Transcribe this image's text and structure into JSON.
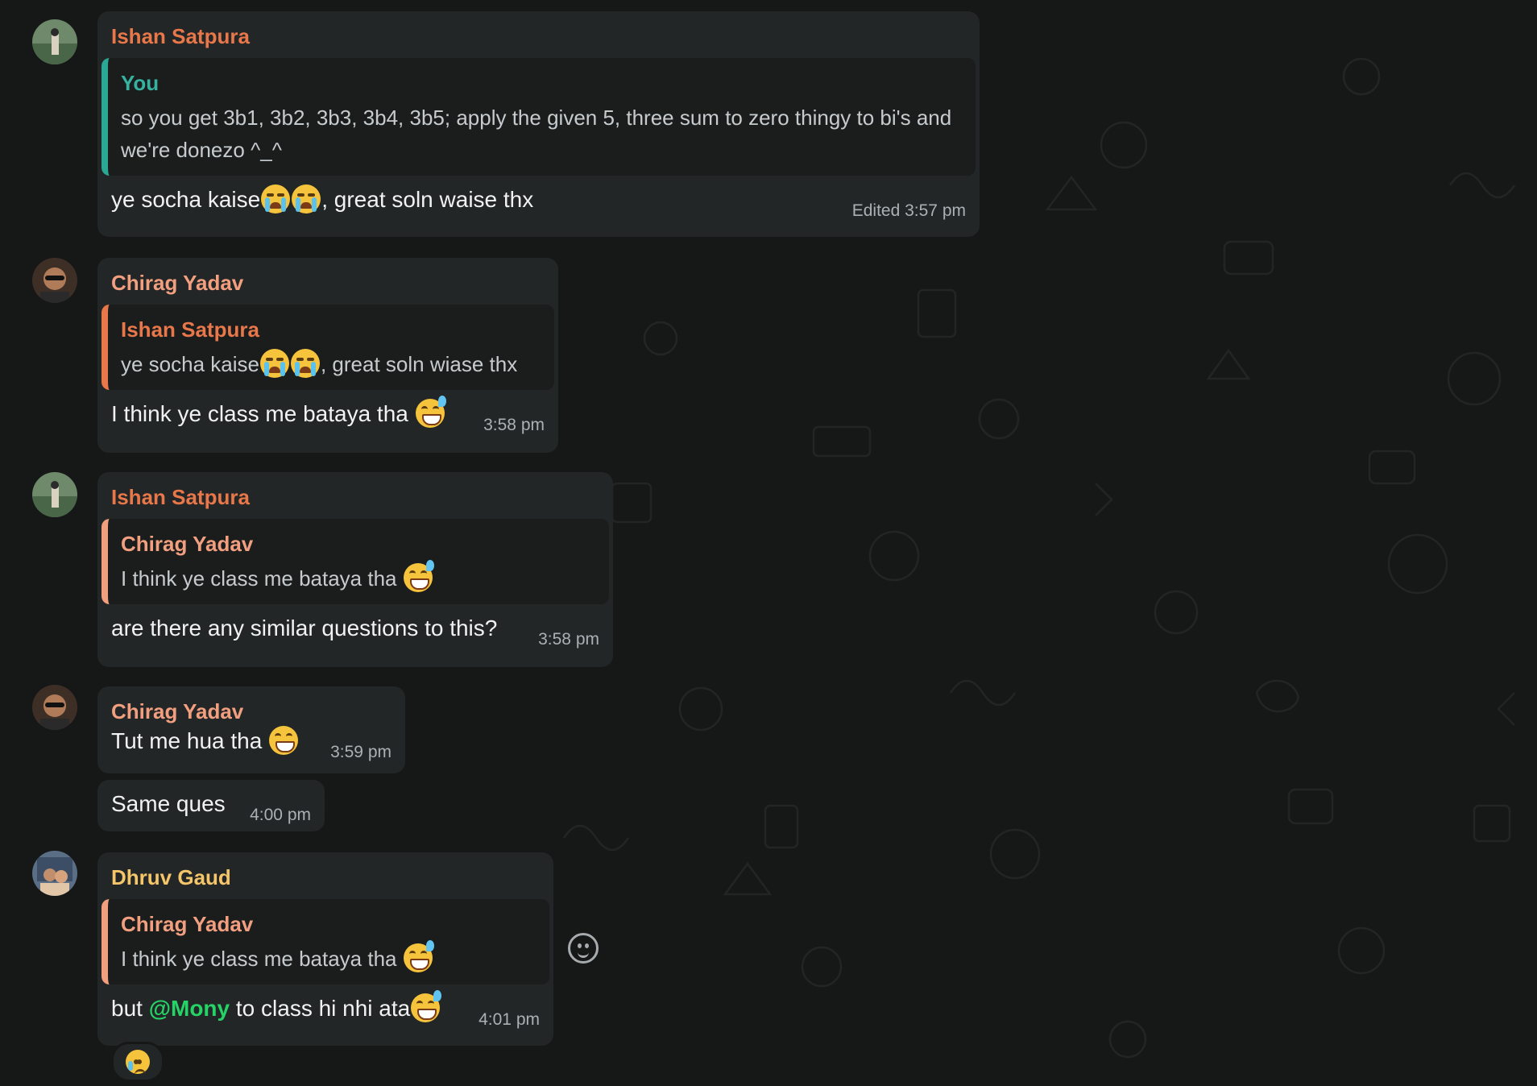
{
  "messages": [
    {
      "sender": "Ishan Satpura",
      "sender_color": "#e8774a",
      "quote": {
        "name": "You",
        "name_color": "#35b3a0",
        "text": "so you get 3b1, 3b2, 3b3, 3b4, 3b5; apply the given 5, three sum to zero thingy to bi's and we're donezo ^_^"
      },
      "text_before": "ye socha kaise",
      "text_after": ", great soln waise thx",
      "time": "Edited 3:57 pm"
    },
    {
      "sender": "Chirag Yadav",
      "sender_color": "#f29f80",
      "quote": {
        "name": "Ishan Satpura",
        "name_color": "#e8774a",
        "text_before": "ye socha kaise",
        "text_after": ", great soln wiase thx"
      },
      "text": "I think ye class me bataya tha ",
      "time": "3:58 pm"
    },
    {
      "sender": "Ishan Satpura",
      "sender_color": "#e8774a",
      "quote": {
        "name": "Chirag Yadav",
        "name_color": "#f29f80",
        "text": "I think ye class me bataya tha "
      },
      "text": "are there any similar questions to this?",
      "time": "3:58 pm"
    },
    {
      "sender": "Chirag Yadav",
      "sender_color": "#f29f80",
      "text": "Tut me hua tha ",
      "time": "3:59 pm"
    },
    {
      "text": "Same ques",
      "time": "4:00 pm"
    },
    {
      "sender": "Dhruv Gaud",
      "sender_color": "#f5c56a",
      "quote": {
        "name": "Chirag Yadav",
        "name_color": "#f29f80",
        "text": "I think ye class me bataya tha "
      },
      "text_before": "but ",
      "mention": "@Mony",
      "text_after": " to class hi nhi ata",
      "time": "4:01 pm",
      "reaction": "crying-face"
    }
  ],
  "icons": {
    "emoji_button": "smiley-icon",
    "crying": "loudly-crying-face-emoji",
    "sweat_smile": "grinning-sweat-emoji",
    "grin": "beaming-face-emoji"
  }
}
